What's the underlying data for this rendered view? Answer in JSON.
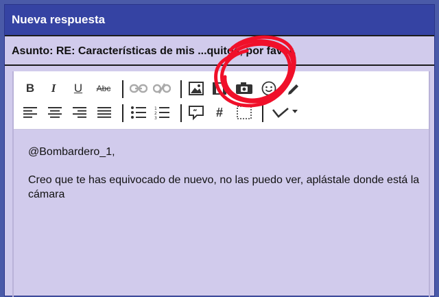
{
  "window": {
    "title": "Nueva respuesta"
  },
  "subject": {
    "text": "Asunto: RE: Características de mis ...quitos, por favor."
  },
  "toolbar": {
    "bold": "B",
    "italic": "I",
    "underline": "U",
    "strikethrough": "Abc",
    "code": "#"
  },
  "message": {
    "line1": "@Bombardero_1,",
    "line2": "Creo que te has equivocado de nuevo, no las puedo ver, aplástale donde está la cámara"
  },
  "colors": {
    "header": "#3543a3",
    "background": "#d1cbec",
    "annotation": "#f0102a"
  }
}
